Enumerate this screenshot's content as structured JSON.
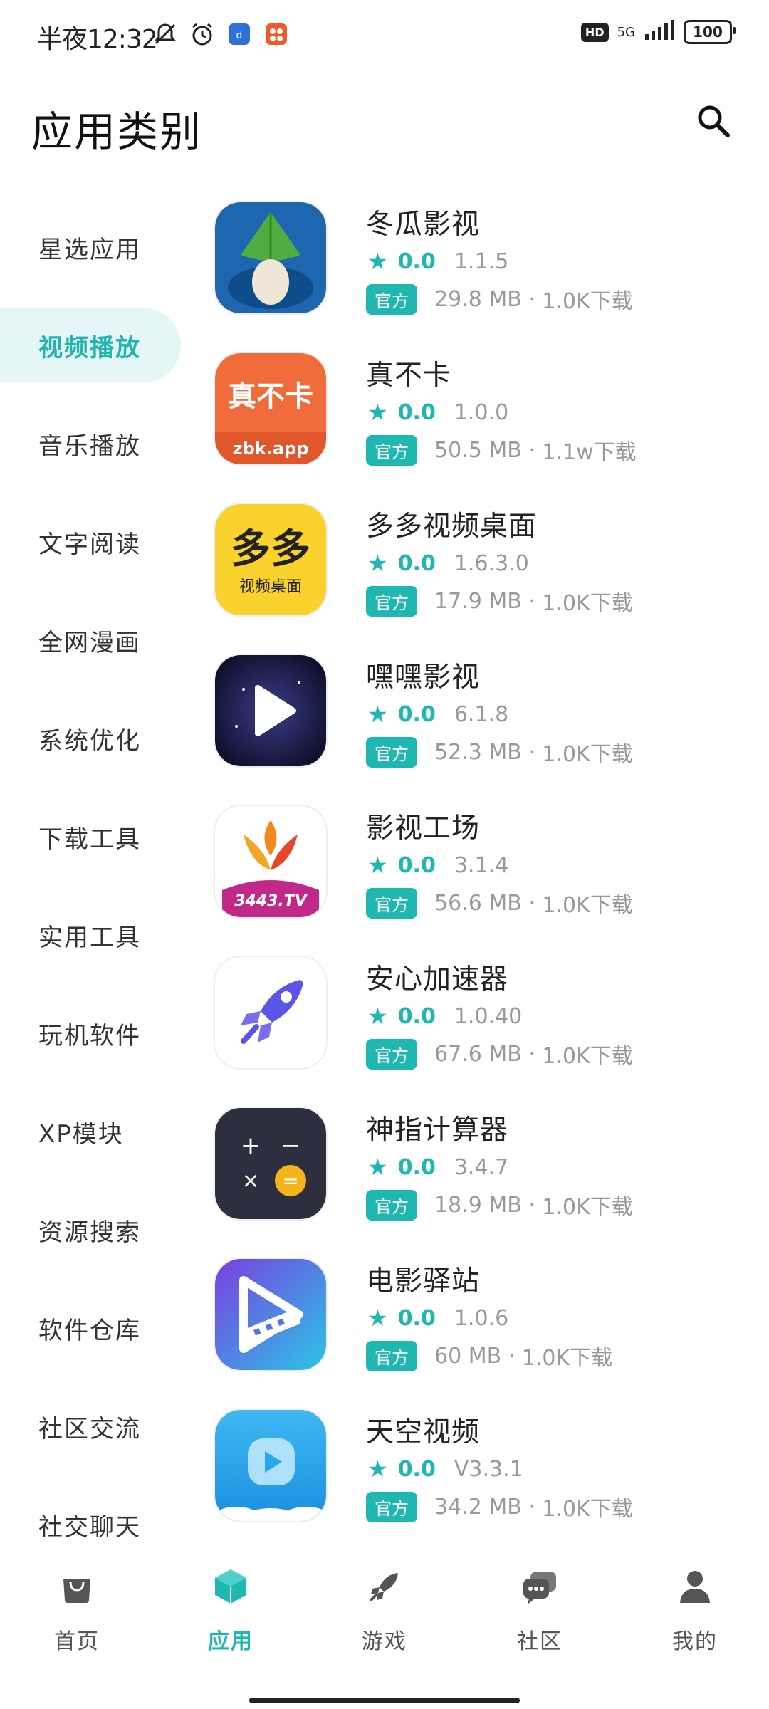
{
  "status_bar": {
    "time": "半夜12:32",
    "battery": "100",
    "network": "5G",
    "hd": "HD"
  },
  "header": {
    "title": "应用类别"
  },
  "sidebar": {
    "items": [
      {
        "label": "星选应用",
        "active": false
      },
      {
        "label": "视频播放",
        "active": true
      },
      {
        "label": "音乐播放",
        "active": false
      },
      {
        "label": "文字阅读",
        "active": false
      },
      {
        "label": "全网漫画",
        "active": false
      },
      {
        "label": "系统优化",
        "active": false
      },
      {
        "label": "下载工具",
        "active": false
      },
      {
        "label": "实用工具",
        "active": false
      },
      {
        "label": "玩机软件",
        "active": false
      },
      {
        "label": "XP模块",
        "active": false
      },
      {
        "label": "资源搜索",
        "active": false
      },
      {
        "label": "软件仓库",
        "active": false
      },
      {
        "label": "社区交流",
        "active": false
      },
      {
        "label": "社交聊天",
        "active": false
      }
    ]
  },
  "apps": [
    {
      "name": "冬瓜影视",
      "score": "0.0",
      "version": "1.1.5",
      "tag": "官方",
      "size": "29.8 MB",
      "downloads": "1.0K下载",
      "icon": "mushroom-app-icon"
    },
    {
      "name": "真不卡",
      "score": "0.0",
      "version": "1.0.0",
      "tag": "官方",
      "size": "50.5 MB",
      "downloads": "1.1w下载",
      "icon": "zbk-app-icon",
      "icon_text": "真不卡",
      "icon_sub": "zbk.app"
    },
    {
      "name": "多多视频桌面",
      "score": "0.0",
      "version": "1.6.3.0",
      "tag": "官方",
      "size": "17.9 MB",
      "downloads": "1.0K下载",
      "icon": "duoduo-app-icon",
      "icon_text": "多多",
      "icon_sub": "视频桌面"
    },
    {
      "name": "嘿嘿影视",
      "score": "0.0",
      "version": "6.1.8",
      "tag": "官方",
      "size": "52.3 MB",
      "downloads": "1.0K下载",
      "icon": "play-app-icon"
    },
    {
      "name": "影视工场",
      "score": "0.0",
      "version": "3.1.4",
      "tag": "官方",
      "size": "56.6 MB",
      "downloads": "1.0K下载",
      "icon": "phoenix-app-icon",
      "icon_sub": "3443.TV"
    },
    {
      "name": "安心加速器",
      "score": "0.0",
      "version": "1.0.40",
      "tag": "官方",
      "size": "67.6 MB",
      "downloads": "1.0K下载",
      "icon": "rocket-app-icon"
    },
    {
      "name": "神指计算器",
      "score": "0.0",
      "version": "3.4.7",
      "tag": "官方",
      "size": "18.9 MB",
      "downloads": "1.0K下载",
      "icon": "calculator-app-icon"
    },
    {
      "name": "电影驿站",
      "score": "0.0",
      "version": "1.0.6",
      "tag": "官方",
      "size": "60 MB",
      "downloads": "1.0K下载",
      "icon": "film-app-icon"
    },
    {
      "name": "天空视频",
      "score": "0.0",
      "version": "V3.3.1",
      "tag": "官方",
      "size": "34.2 MB",
      "downloads": "1.0K下载",
      "icon": "sky-play-app-icon"
    }
  ],
  "bottom_nav": [
    {
      "label": "首页",
      "icon": "bag-icon",
      "active": false
    },
    {
      "label": "应用",
      "icon": "cube-icon",
      "active": true
    },
    {
      "label": "游戏",
      "icon": "rocket-icon",
      "active": false
    },
    {
      "label": "社区",
      "icon": "chat-icon",
      "active": false
    },
    {
      "label": "我的",
      "icon": "person-icon",
      "active": false
    }
  ],
  "colors": {
    "accent": "#1fb7b2",
    "active_bg": "#e4f6f5"
  }
}
